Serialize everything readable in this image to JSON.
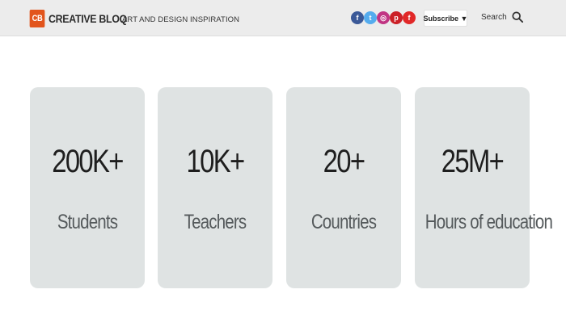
{
  "header": {
    "logo_badge": "CB",
    "logo_text": "CREATIVE BLOQ",
    "tagline": "ART AND DESIGN INSPIRATION",
    "social": [
      {
        "icon": "facebook-icon",
        "glyph": "f",
        "color": "#3b5998"
      },
      {
        "icon": "twitter-icon",
        "glyph": "t",
        "color": "#55acee"
      },
      {
        "icon": "instagram-icon",
        "glyph": "◎",
        "color": "#c13584"
      },
      {
        "icon": "pinterest-icon",
        "glyph": "p",
        "color": "#cb2027"
      },
      {
        "icon": "flipboard-icon",
        "glyph": "f",
        "color": "#e12828"
      }
    ],
    "subscribe_label": "Subscribe ▼",
    "search_label": "Search"
  },
  "stats": [
    {
      "value": "200K+",
      "label": "Students"
    },
    {
      "value": "10K+",
      "label": "Teachers"
    },
    {
      "value": "20+",
      "label": "Countries"
    },
    {
      "value": "25M+",
      "label": "Hours of education"
    }
  ]
}
